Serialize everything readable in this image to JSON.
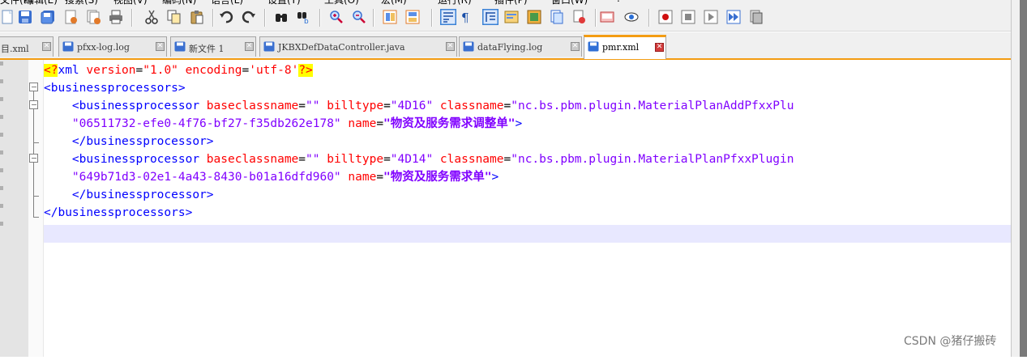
{
  "colors": {
    "tag": "#0000ff",
    "attr": "#ff0000",
    "value": "#8000ff",
    "active_tab_accent": "#f39c12",
    "current_line": "#e8e8ff"
  },
  "toolbar": {
    "icons": [
      "new-icon",
      "save-icon",
      "save-all-icon",
      "close-icon",
      "close-all-icon",
      "print-icon",
      "cut-icon",
      "copy-icon",
      "paste-icon",
      "undo-icon",
      "redo-icon",
      "find-icon",
      "replace-icon",
      "zoom-in-icon",
      "zoom-out-icon",
      "sync-v-icon",
      "sync-h-icon",
      "word-wrap-icon",
      "show-all-chars-icon",
      "indent-guide-icon",
      "udl-icon",
      "doc-map-icon",
      "function-list-icon",
      "folder-workspace-icon",
      "monitor-icon",
      "eye-icon",
      "record-macro-icon",
      "stop-macro-icon",
      "play-macro-icon",
      "run-macro-multiple-icon",
      "save-macro-icon"
    ],
    "pilcrow": "¶"
  },
  "tabs": [
    {
      "label": "目.xml",
      "active": false
    },
    {
      "label": "pfxx-log.log",
      "active": false
    },
    {
      "label": "新文件 1",
      "active": false
    },
    {
      "label": "JKBXDefDataController.java",
      "active": false
    },
    {
      "label": "dataFlying.log",
      "active": false
    },
    {
      "label": "pmr.xml",
      "active": true
    }
  ],
  "code": {
    "l1": {
      "pi_open": "<?",
      "tag": "xml",
      "a1": " version",
      "eq1": "=",
      "v1": "\"1.0\"",
      "a2": " encoding",
      "eq2": "=",
      "v2": "'utf-8'",
      "pi_close": "?>"
    },
    "l2": {
      "tag": "<businessprocessors>"
    },
    "l3": {
      "indent": "    ",
      "tag": "<businessprocessor",
      "a1": " baseclassname",
      "eq1": "=",
      "v1": "\"\"",
      "a2": " billtype",
      "eq2": "=",
      "v2": "\"4D16\"",
      "a3": " classname",
      "eq3": "=",
      "v3": "\"nc.bs.pbm.plugin.MaterialPlanAddPfxxPlu"
    },
    "l4": {
      "indent": "    ",
      "v1": "\"06511732-efe0-4f76-bf27-f35db262e178\"",
      "a1": " name",
      "eq1": "=",
      "v2": "\"物资及服务需求调整单\"",
      "close": ">"
    },
    "l5": {
      "indent": "    ",
      "tag": "</businessprocessor>"
    },
    "l6": {
      "indent": "    ",
      "tag": "<businessprocessor",
      "a1": " baseclassname",
      "eq1": "=",
      "v1": "\"\"",
      "a2": " billtype",
      "eq2": "=",
      "v2": "\"4D14\"",
      "a3": " classname",
      "eq3": "=",
      "v3": "\"nc.bs.pbm.plugin.MaterialPlanPfxxPlugin"
    },
    "l7": {
      "indent": "    ",
      "v1": "\"649b71d3-02e1-4a43-8430-b01a16dfd960\"",
      "a1": " name",
      "eq1": "=",
      "v2": "\"物资及服务需求单\"",
      "close": ">"
    },
    "l8": {
      "indent": "    ",
      "tag": "</businessprocessor>"
    },
    "l9": {
      "tag": "</businessprocessors>"
    }
  },
  "watermark": "CSDN @猪仔搬砖"
}
